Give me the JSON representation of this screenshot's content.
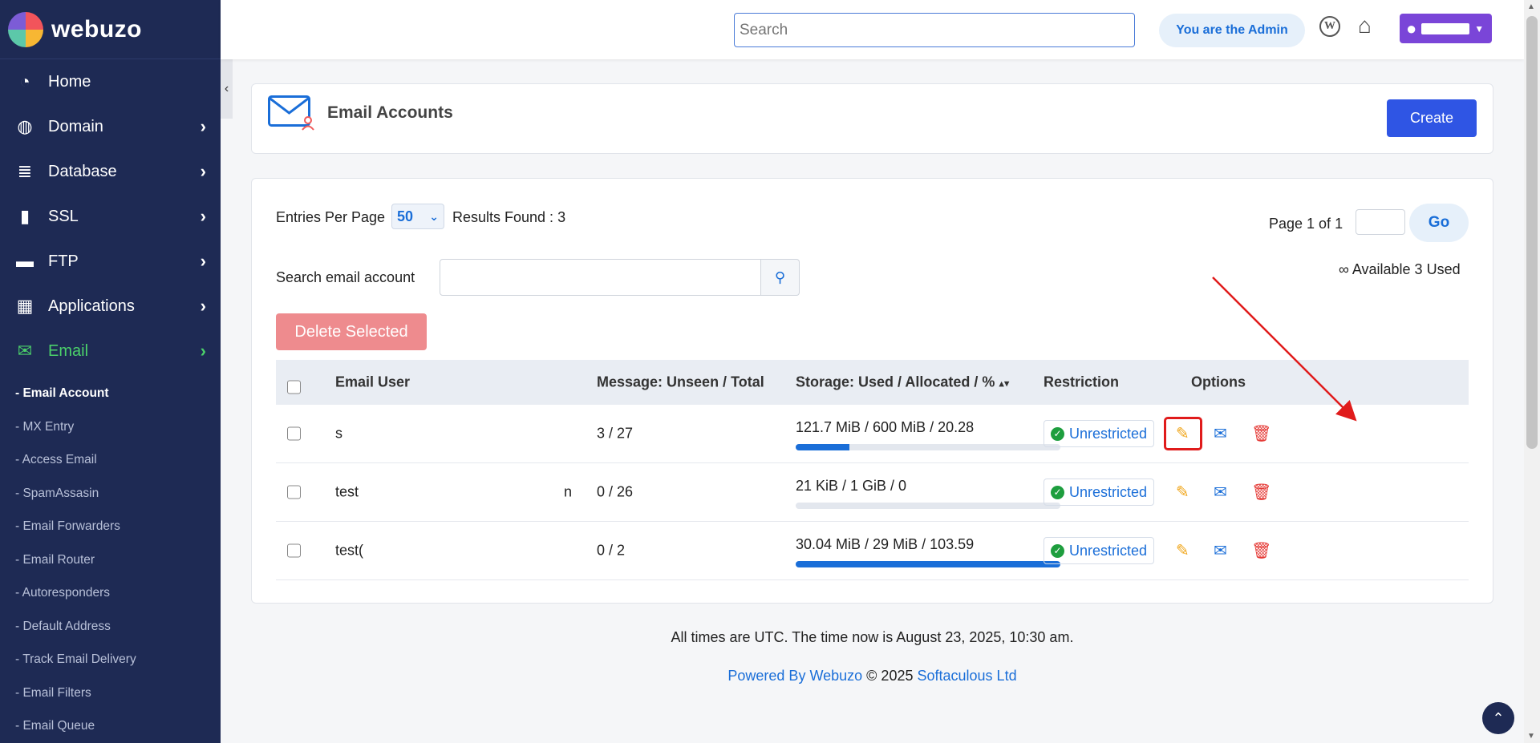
{
  "app": {
    "brand": "webuzo"
  },
  "sidebar": {
    "items": [
      {
        "label": "Home",
        "icon": "dashboard-icon"
      },
      {
        "label": "Domain",
        "icon": "globe-icon"
      },
      {
        "label": "Database",
        "icon": "database-icon"
      },
      {
        "label": "SSL",
        "icon": "file-icon"
      },
      {
        "label": "FTP",
        "icon": "folder-icon"
      },
      {
        "label": "Applications",
        "icon": "grid-icon"
      },
      {
        "label": "Email",
        "icon": "envelope-icon"
      }
    ],
    "sub_items": [
      "- Email Account",
      "- MX Entry",
      "- Access Email",
      "- SpamAssasin",
      "- Email Forwarders",
      "- Email Router",
      "- Autoresponders",
      "- Default Address",
      "- Track Email Delivery",
      "- Email Filters",
      "- Email Queue"
    ]
  },
  "topbar": {
    "search_placeholder": "Search",
    "admin_label": "You are the Admin"
  },
  "page": {
    "title": "Email Accounts",
    "create_label": "Create"
  },
  "controls": {
    "entries_label": "Entries Per Page",
    "entries_value": "50",
    "results_label": "Results Found : 3",
    "page_label": "Page 1 of 1",
    "go_label": "Go",
    "available_label": "∞ Available 3 Used",
    "search_label": "Search email account",
    "delete_label": "Delete Selected"
  },
  "table": {
    "headers": {
      "email_user": "Email User",
      "message": "Message: Unseen / Total",
      "storage": "Storage: Used / Allocated / %",
      "restriction": "Restriction",
      "options": "Options"
    },
    "rows": [
      {
        "email": "s",
        "email_tail": "",
        "message": "3 / 27",
        "storage": "121.7 MiB / 600 MiB / 20.28",
        "storage_percent": 20.28,
        "restriction": "Unrestricted"
      },
      {
        "email": "test",
        "email_tail": "n",
        "message": "0 / 26",
        "storage": "21 KiB / 1 GiB / 0",
        "storage_percent": 0,
        "restriction": "Unrestricted"
      },
      {
        "email": "test(",
        "email_tail": "",
        "message": "0 / 2",
        "storage": "30.04 MiB / 29 MiB / 103.59",
        "storage_percent": 100,
        "restriction": "Unrestricted"
      }
    ]
  },
  "footer": {
    "time_text": "All times are UTC. The time now is August 23, 2025, 10:30 am.",
    "powered_by": "Powered By Webuzo",
    "copyright": "© 2025",
    "company": "Softaculous Ltd"
  },
  "colors": {
    "sidebar_bg": "#1e2a54",
    "accent": "#2f55e4",
    "active_nav": "#4bd06a",
    "danger": "#e53935",
    "edit": "#f0a416"
  }
}
